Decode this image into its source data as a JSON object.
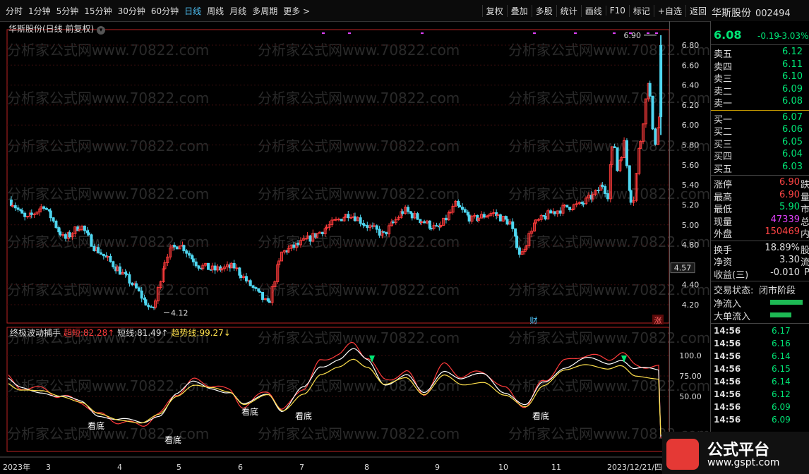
{
  "toolbar": {
    "periods": [
      "分时",
      "1分钟",
      "5分钟",
      "15分钟",
      "30分钟",
      "60分钟",
      "日线",
      "周线",
      "月线",
      "多周期",
      "更多 >"
    ],
    "active_period": "日线",
    "right_buttons": [
      "复权",
      "叠加",
      "多股",
      "统计",
      "画线",
      "F10",
      "标记",
      "+自选",
      "返回"
    ]
  },
  "stock": {
    "name": "华斯股份",
    "code": "002494",
    "price": "6.08",
    "change": "-0.19",
    "change_pct": "-3.03%"
  },
  "main_chart": {
    "title": "华斯股份(日线 前复权)",
    "y_ticks": [
      "6.80",
      "6.60",
      "6.40",
      "6.20",
      "6.00",
      "5.80",
      "5.60",
      "5.40",
      "5.20",
      "5.00",
      "4.80",
      "4.40",
      "4.20"
    ],
    "y_values": [
      6.8,
      6.6,
      6.4,
      6.2,
      6.0,
      5.8,
      5.6,
      5.4,
      5.2,
      5.0,
      4.8,
      4.4,
      4.2
    ],
    "y_label_min": "4.12",
    "y_label_max": "6.90",
    "cursor_value": "4.57",
    "marker_cai": "财",
    "marker_zhang": "涨",
    "watermark": "分析家公式网www.70822.com"
  },
  "indicator": {
    "name": "终极波动捕手",
    "l1_label": "超短:",
    "l1_value": "82.28↑",
    "l2_label": "短线:",
    "l2_value": "81.49↑",
    "l3_label": "趋势线:",
    "l3_value": "99.27↓",
    "y_ticks": [
      "100.0",
      "75.00",
      "50.00"
    ],
    "y_values": [
      100,
      75,
      50
    ],
    "kandi": "看底"
  },
  "x_axis": {
    "labels": [
      "2023年",
      "3",
      "4",
      "5",
      "6",
      "7",
      "8",
      "9",
      "10",
      "11",
      "2023/12/21/四"
    ]
  },
  "quote_panel": {
    "sell": [
      {
        "label": "卖五",
        "price": "6.12"
      },
      {
        "label": "卖四",
        "price": "6.11"
      },
      {
        "label": "卖三",
        "price": "6.10"
      },
      {
        "label": "卖二",
        "price": "6.09"
      },
      {
        "label": "卖一",
        "price": "6.08"
      }
    ],
    "buy": [
      {
        "label": "买一",
        "price": "6.07"
      },
      {
        "label": "买二",
        "price": "6.06"
      },
      {
        "label": "买三",
        "price": "6.05"
      },
      {
        "label": "买四",
        "price": "6.04"
      },
      {
        "label": "买五",
        "price": "6.03"
      }
    ],
    "stats": [
      {
        "label": "涨停",
        "value": "6.90",
        "suffix": "跌"
      },
      {
        "label": "最高",
        "value": "6.90",
        "suffix": "量"
      },
      {
        "label": "最低",
        "value": "5.90",
        "suffix": "市"
      },
      {
        "label": "现量",
        "value": "47339",
        "suffix": "总"
      },
      {
        "label": "外盘",
        "value": "150469",
        "suffix": "内"
      }
    ],
    "finance": [
      {
        "label": "换手",
        "value": "18.89%",
        "suffix": "股"
      },
      {
        "label": "净资",
        "value": "3.30",
        "suffix": "流"
      },
      {
        "label": "收益(三)",
        "value": "-0.010",
        "suffix": "P"
      }
    ],
    "trade_status_label": "交易状态:",
    "trade_status_value": "闭市阶段",
    "net_inflow": "净流入",
    "big_inflow": "大单流入"
  },
  "ticks": [
    {
      "time": "14:56",
      "price": "6.17"
    },
    {
      "time": "14:56",
      "price": "6.16"
    },
    {
      "time": "14:56",
      "price": "6.14"
    },
    {
      "time": "14:56",
      "price": "6.15"
    },
    {
      "time": "14:56",
      "price": "6.14"
    },
    {
      "time": "14:56",
      "price": "6.12"
    },
    {
      "time": "14:56",
      "price": "6.09"
    },
    {
      "time": "14:56",
      "price": "6.09"
    }
  ],
  "logo": {
    "title": "公式平台",
    "url": "www.gspt.com"
  },
  "colors": {
    "up": "#ff3b3b",
    "down": "#4ed6f0",
    "green": "#00e676",
    "yellow": "#ffe14d",
    "purple": "#e040fb"
  }
}
